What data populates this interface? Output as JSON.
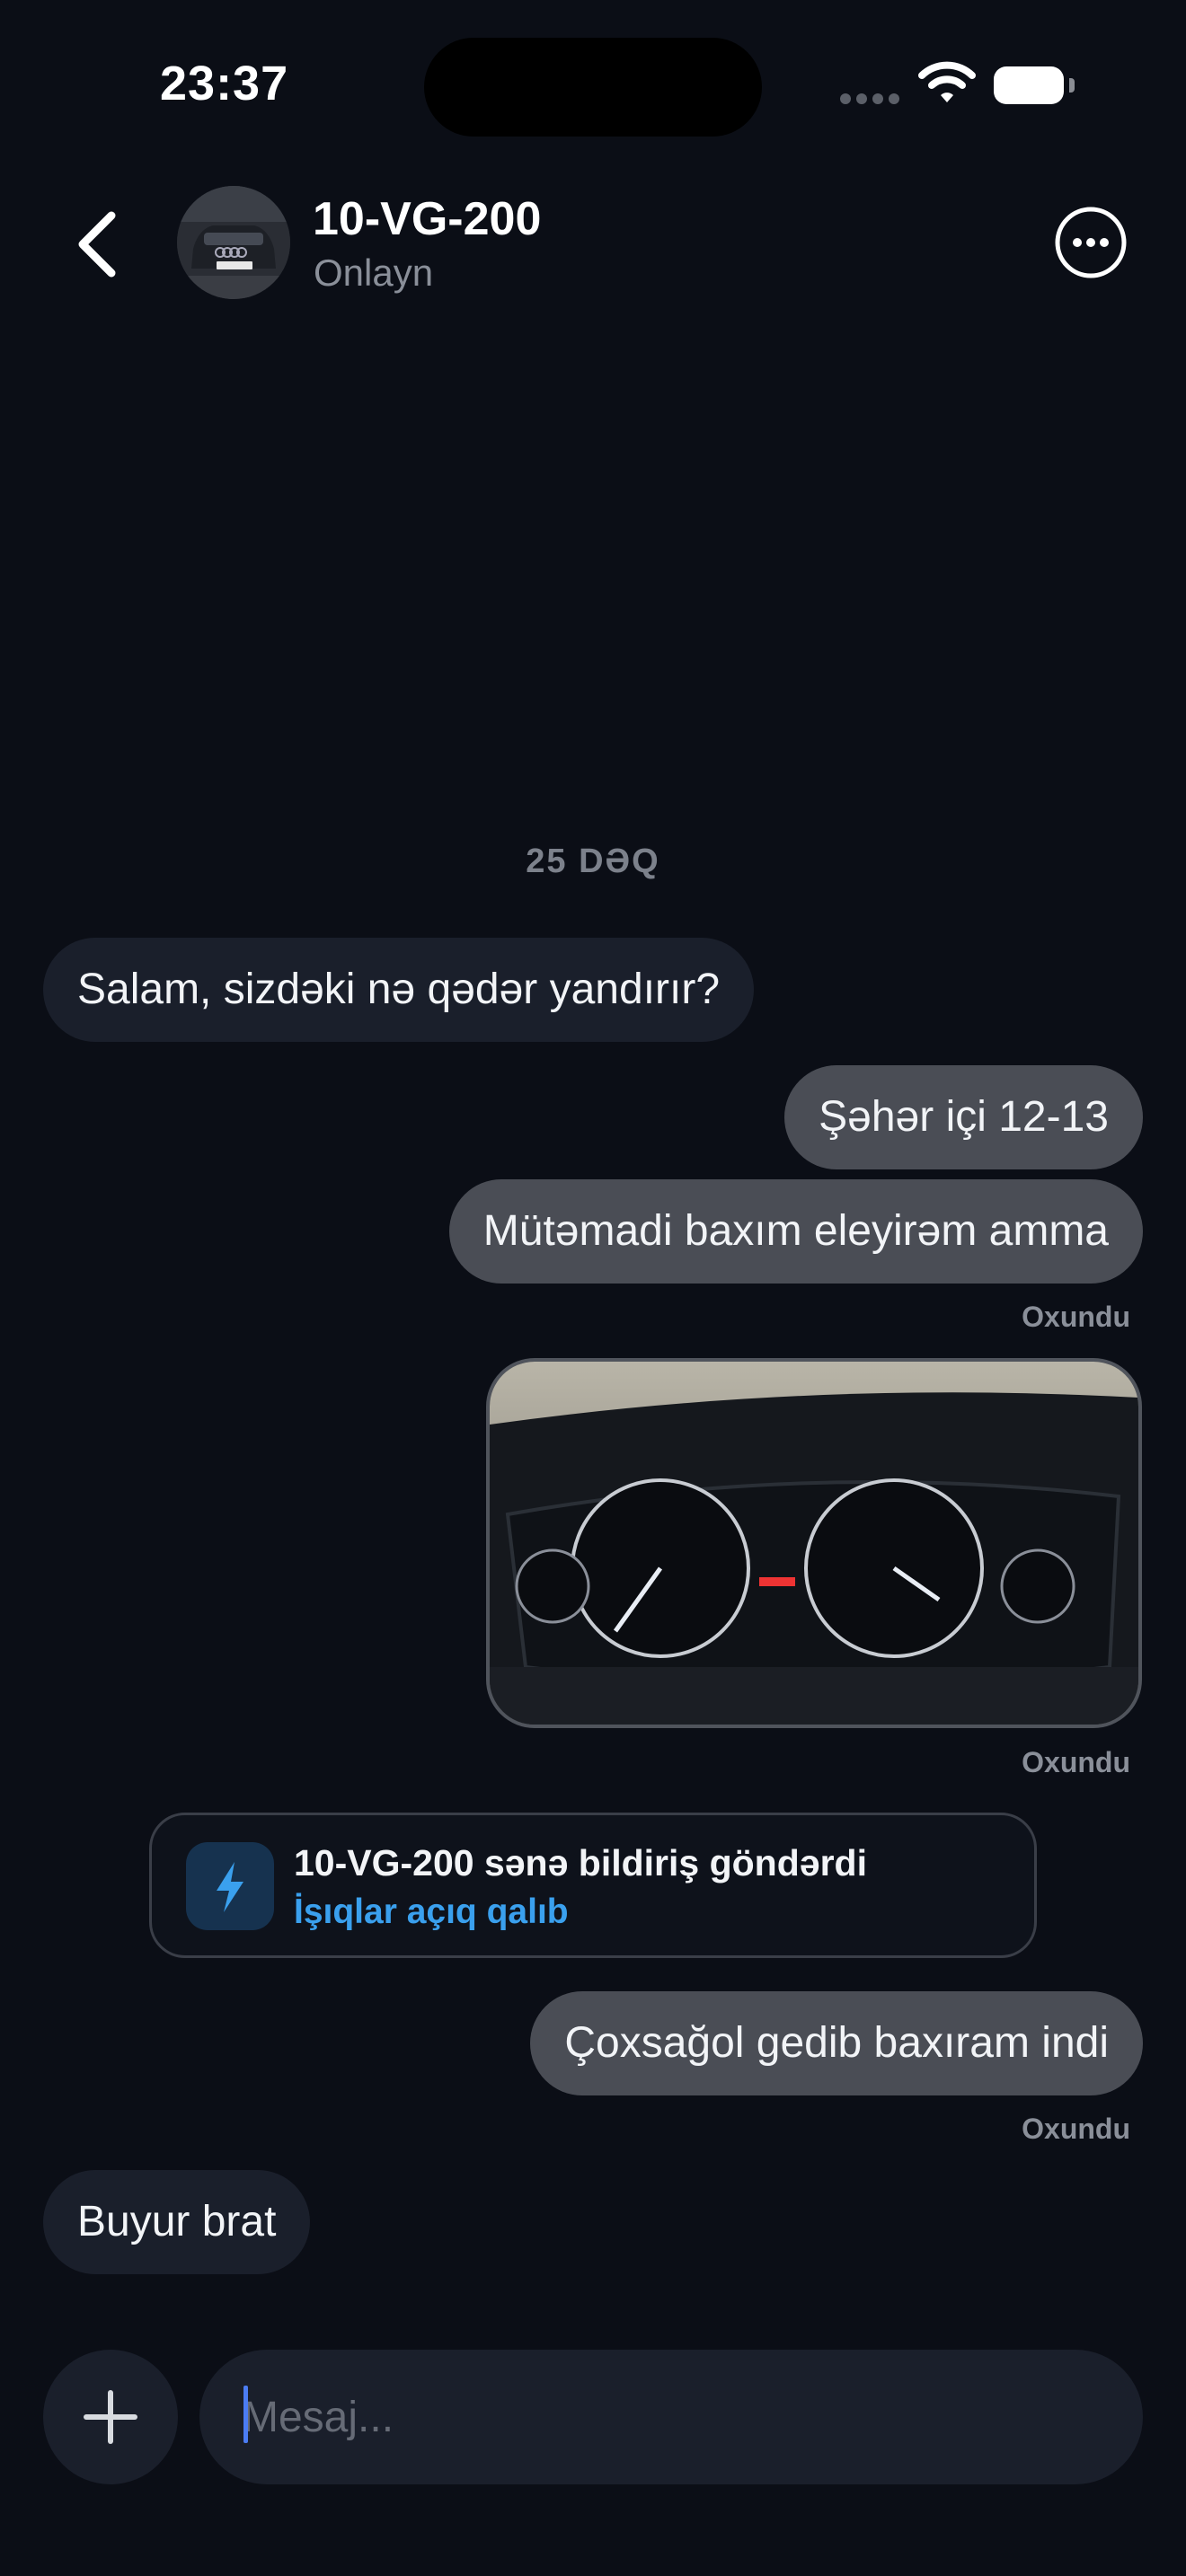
{
  "status_bar": {
    "time": "23:37",
    "icons": [
      "cellular-signal-icon",
      "wifi-icon",
      "battery-icon"
    ]
  },
  "header": {
    "title": "10-VG-200",
    "subtitle": "Onlayn",
    "back_icon": "chevron-left-icon",
    "more_icon": "more-horizontal-icon"
  },
  "chat": {
    "date_separator": "25 DƏQ",
    "messages": [
      {
        "direction": "incoming",
        "text": "Salam, sizdəki nə qədər yandırır?"
      },
      {
        "direction": "outgoing",
        "text": "Şəhər içi 12-13"
      },
      {
        "direction": "outgoing",
        "text": "Mütəmadi baxım eleyirəm amma",
        "status": "Oxundu"
      },
      {
        "direction": "outgoing",
        "type": "image",
        "alt": "dashboard-photo",
        "status": "Oxundu"
      },
      {
        "direction": "outgoing",
        "text": "Çoxsağol gedib baxıram indi",
        "status": "Oxundu"
      },
      {
        "direction": "incoming",
        "text": "Buyur brat"
      }
    ],
    "notice": {
      "title": "10-VG-200 sənə bildiriş göndərdi",
      "subtitle": "İşıqlar açıq qalıb",
      "icon": "lightning-icon"
    }
  },
  "composer": {
    "placeholder": "Mesaj...",
    "add_icon": "plus-icon"
  },
  "colors": {
    "background": "#0b0e16",
    "incoming_bubble": "#1a1f2b",
    "outgoing_bubble": "#4a4d55",
    "accent": "#3aa0ee",
    "caret": "#4b7cf3"
  }
}
